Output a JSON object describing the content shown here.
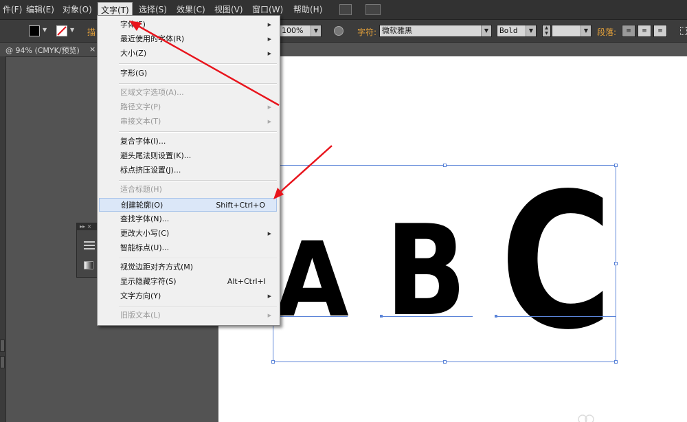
{
  "menubar": {
    "items": [
      "件(F)",
      "编辑(E)",
      "对象(O)",
      "文字(T)",
      "选择(S)",
      "效果(C)",
      "视图(V)",
      "窗口(W)",
      "帮助(H)"
    ],
    "active_index": 3
  },
  "controlbar": {
    "truncated_label": "描",
    "zoom_value": "100%",
    "char_label": "字符:",
    "font_family": "微软雅黑",
    "font_style": "Bold",
    "para_label": "段落:"
  },
  "document_tab": {
    "title": "@ 94% (CMYK/预览)",
    "close": "×"
  },
  "text_menu": {
    "items": [
      {
        "label": "字体(F)",
        "shortcut": "",
        "submenu": true,
        "disabled": false
      },
      {
        "label": "最近使用的字体(R)",
        "shortcut": "",
        "submenu": true,
        "disabled": false
      },
      {
        "label": "大小(Z)",
        "shortcut": "",
        "submenu": true,
        "disabled": false
      },
      {
        "label": "字形(G)",
        "shortcut": "",
        "submenu": false,
        "disabled": false
      },
      {
        "label": "区域文字选项(A)...",
        "shortcut": "",
        "submenu": false,
        "disabled": true
      },
      {
        "label": "路径文字(P)",
        "shortcut": "",
        "submenu": true,
        "disabled": true
      },
      {
        "label": "串接文本(T)",
        "shortcut": "",
        "submenu": true,
        "disabled": true
      },
      {
        "label": "复合字体(I)...",
        "shortcut": "",
        "submenu": false,
        "disabled": false
      },
      {
        "label": "避头尾法则设置(K)...",
        "shortcut": "",
        "submenu": false,
        "disabled": false
      },
      {
        "label": "标点挤压设置(J)...",
        "shortcut": "",
        "submenu": false,
        "disabled": false
      },
      {
        "label": "适合标题(H)",
        "shortcut": "",
        "submenu": false,
        "disabled": true
      },
      {
        "label": "创建轮廓(O)",
        "shortcut": "Shift+Ctrl+O",
        "submenu": false,
        "disabled": false,
        "highlighted": true
      },
      {
        "label": "查找字体(N)...",
        "shortcut": "",
        "submenu": false,
        "disabled": false
      },
      {
        "label": "更改大小写(C)",
        "shortcut": "",
        "submenu": true,
        "disabled": false
      },
      {
        "label": "智能标点(U)...",
        "shortcut": "",
        "submenu": false,
        "disabled": false
      },
      {
        "label": "视觉边距对齐方式(M)",
        "shortcut": "",
        "submenu": false,
        "disabled": false
      },
      {
        "label": "显示隐藏字符(S)",
        "shortcut": "Alt+Ctrl+I",
        "submenu": false,
        "disabled": false
      },
      {
        "label": "文字方向(Y)",
        "shortcut": "",
        "submenu": true,
        "disabled": false
      },
      {
        "label": "旧版文本(L)",
        "shortcut": "",
        "submenu": true,
        "disabled": true
      }
    ]
  },
  "canvas": {
    "letters": [
      "A",
      "B",
      "C"
    ]
  },
  "colors": {
    "selection": "#5b84d8",
    "annotation_arrow": "#e8141c",
    "accent_label": "#e8a33a"
  }
}
